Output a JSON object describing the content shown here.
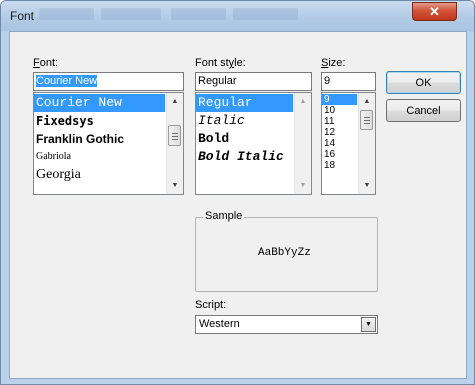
{
  "window": {
    "title": "Font",
    "close_glyph": "✕"
  },
  "font": {
    "label_prefix": "",
    "label_hotkey": "F",
    "label_rest": "ont:",
    "value": "Courier New",
    "items": [
      {
        "label": "Courier New",
        "selected": true
      },
      {
        "label": "Fixedsys",
        "selected": false
      },
      {
        "label": "Franklin Gothic",
        "selected": false
      },
      {
        "label": "Gabriola",
        "selected": false
      },
      {
        "label": "Georgia",
        "selected": false
      }
    ]
  },
  "style": {
    "label_prefix": "Font st",
    "label_hotkey": "y",
    "label_rest": "le:",
    "value": "Regular",
    "items": [
      {
        "label": "Regular",
        "selected": true
      },
      {
        "label": "Italic",
        "selected": false
      },
      {
        "label": "Bold",
        "selected": false
      },
      {
        "label": "Bold Italic",
        "selected": false
      }
    ]
  },
  "size": {
    "label_prefix": "",
    "label_hotkey": "S",
    "label_rest": "ize:",
    "value": "9",
    "items": [
      {
        "label": "9",
        "selected": true
      },
      {
        "label": "10",
        "selected": false
      },
      {
        "label": "11",
        "selected": false
      },
      {
        "label": "12",
        "selected": false
      },
      {
        "label": "14",
        "selected": false
      },
      {
        "label": "16",
        "selected": false
      },
      {
        "label": "18",
        "selected": false
      }
    ]
  },
  "buttons": {
    "ok": "OK",
    "cancel": "Cancel"
  },
  "sample": {
    "label": "Sample",
    "text": "AaBbYyZz"
  },
  "script": {
    "label": "Script:",
    "value": "Western"
  },
  "icons": {
    "up": "▲",
    "down": "▼"
  },
  "colors": {
    "selection": "#3399ff",
    "close_button": "#c9442a",
    "frame": "#b9d1ea"
  }
}
